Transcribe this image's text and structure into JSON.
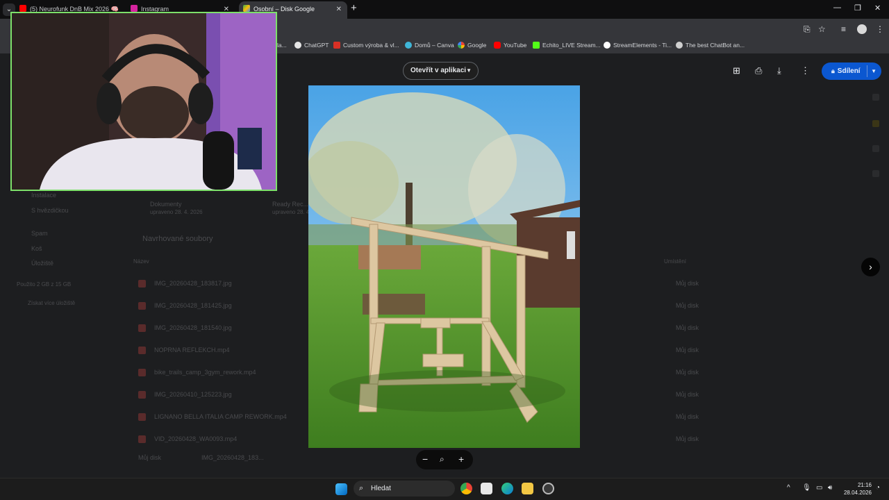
{
  "tabs": [
    {
      "title": "(5) Neurofunk DnB Mix 2026 🧠",
      "icon": "youtube-icon"
    },
    {
      "title": "Instagram",
      "icon": "instagram-icon"
    },
    {
      "title": "Osobní – Disk Google",
      "icon": "google-drive-icon",
      "active": true
    }
  ],
  "bookmarks": [
    {
      "label": "la...",
      "icon": "bookmark-icon"
    },
    {
      "label": "ChatGPT",
      "icon": "chatgpt-icon"
    },
    {
      "label": "Custom výroba & vl...",
      "icon": "bookmark-icon"
    },
    {
      "label": "Domů – Canva",
      "icon": "canva-icon"
    },
    {
      "label": "Google",
      "icon": "google-icon"
    },
    {
      "label": "YouTube",
      "icon": "youtube-icon"
    },
    {
      "label": "Echito_LIVE Stream...",
      "icon": "kick-icon"
    },
    {
      "label": "StreamElements - Ti...",
      "icon": "streamelements-icon"
    },
    {
      "label": "The best ChatBot an...",
      "icon": "chatbot-icon"
    }
  ],
  "viewer": {
    "open_in_app": "Otevřít v aplikaci",
    "share": "Sdílení",
    "prev_zoom": "−",
    "next_zoom": "+"
  },
  "drive": {
    "sidebar": [
      "Instalace",
      "S hvězdičkou",
      "Spam",
      "Koš",
      "Úložiště",
      "Použito 2 GB z 15 GB",
      "Získat více úložiště"
    ],
    "folders": [
      {
        "name": "Dokumenty",
        "meta": "upraveno 28. 4. 2026"
      },
      {
        "name": "Ready Rec...",
        "meta": "upraveno 28. 4. 2026"
      }
    ],
    "section_title": "Navrhované soubory",
    "col_name": "Název",
    "col_location": "Umístění",
    "files": [
      {
        "name": "IMG_20260428_183817.jpg",
        "location": "Můj disk"
      },
      {
        "name": "IMG_20260428_181425.jpg",
        "location": "Můj disk"
      },
      {
        "name": "IMG_20260428_181540.jpg",
        "location": "Můj disk"
      },
      {
        "name": "NOPRNA REFLEKCH.mp4",
        "location": "Můj disk"
      },
      {
        "name": "bike_trails_camp_3gym_rework.mp4",
        "location": "Můj disk"
      },
      {
        "name": "IMG_20260410_125223.jpg",
        "location": "Můj disk"
      },
      {
        "name": "LIGNANO BELLA ITALIA CAMP REWORK.mp4",
        "location": "Můj disk"
      },
      {
        "name": "VID_20260428_WA0093.mp4",
        "location": "Můj disk"
      }
    ],
    "breadcrumb": [
      "Můj disk",
      "IMG_20260428_183..."
    ]
  },
  "taskbar": {
    "search": "Hledat",
    "time": "21:16",
    "date": "28.04.2026"
  },
  "colors": {
    "accent": "#0b57d0",
    "webcam_border": "#7de06a"
  }
}
